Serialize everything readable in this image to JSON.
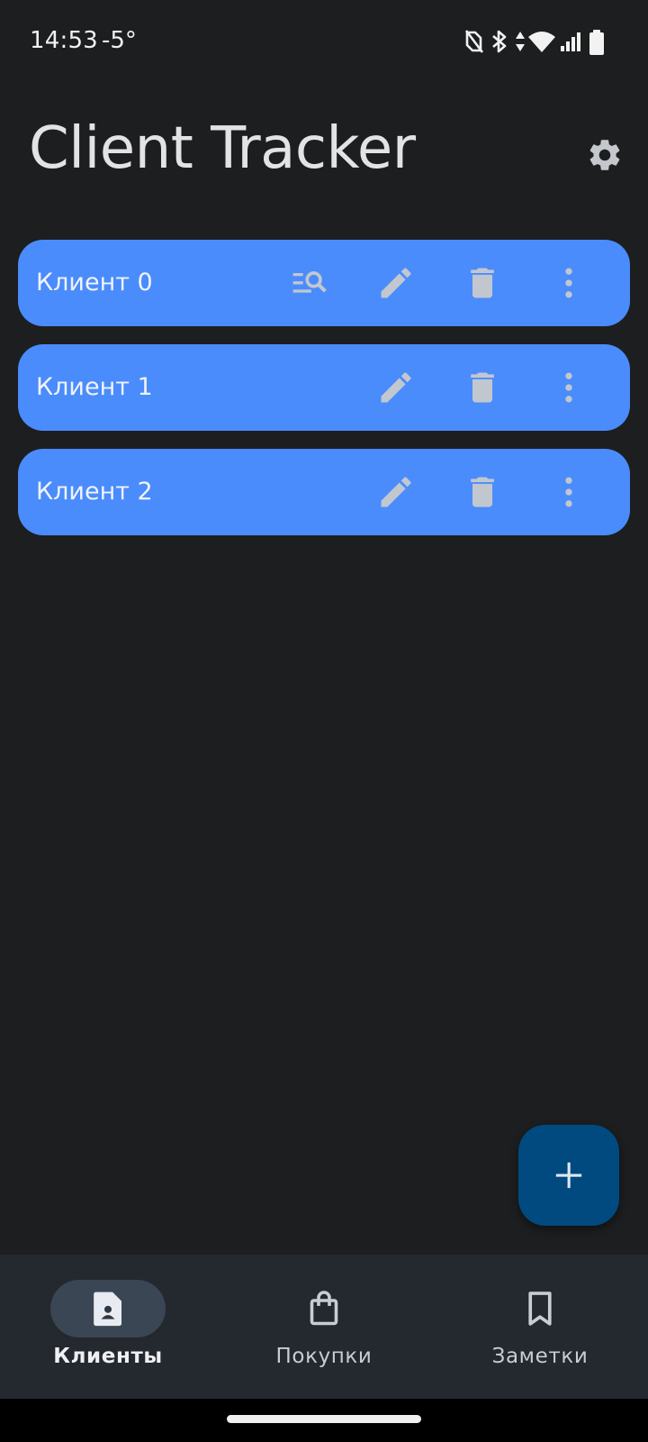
{
  "status_bar": {
    "time": "14:53",
    "temperature": "-5°",
    "icons": [
      "nfc-off-icon",
      "bluetooth-icon",
      "data-arrows-icon",
      "wifi-icon",
      "signal-icon",
      "battery-icon"
    ]
  },
  "header": {
    "title": "Client Tracker",
    "settings_icon": "gear-icon"
  },
  "clients": [
    {
      "name": "Клиент 0",
      "actions": [
        "search-list-icon",
        "edit-icon",
        "delete-icon",
        "more-vert-icon"
      ]
    },
    {
      "name": "Клиент 1",
      "actions": [
        "edit-icon",
        "delete-icon",
        "more-vert-icon"
      ]
    },
    {
      "name": "Клиент 2",
      "actions": [
        "edit-icon",
        "delete-icon",
        "more-vert-icon"
      ]
    }
  ],
  "fab": {
    "icon": "plus-icon"
  },
  "bottom_nav": {
    "items": [
      {
        "label": "Клиенты",
        "icon": "contact-file-icon",
        "active": true
      },
      {
        "label": "Покупки",
        "icon": "shopping-bag-icon",
        "active": false
      },
      {
        "label": "Заметки",
        "icon": "bookmark-icon",
        "active": false
      }
    ]
  },
  "colors": {
    "background": "#1d1e20",
    "card": "#4a8cfc",
    "card_icon": "#c2c7cf",
    "fab": "#004a80",
    "nav_background": "#24282f",
    "nav_active_pill": "#3b4654"
  }
}
